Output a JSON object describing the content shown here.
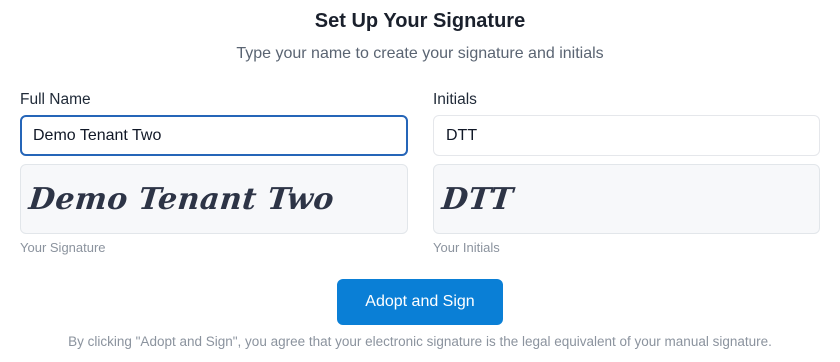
{
  "header": {
    "title": "Set Up Your Signature",
    "subtitle": "Type your name to create your signature and initials"
  },
  "full_name": {
    "label": "Full Name",
    "value": "Demo Tenant Two",
    "preview_text": "Demo Tenant Two",
    "caption": "Your Signature"
  },
  "initials": {
    "label": "Initials",
    "value": "DTT",
    "preview_text": "DTT",
    "caption": "Your Initials"
  },
  "actions": {
    "adopt_label": "Adopt and Sign"
  },
  "footer": {
    "legal_text": "By clicking \"Adopt and Sign\", you agree that your electronic signature is the legal equivalent of your manual signature."
  },
  "colors": {
    "accent": "#0a7fd6",
    "focus_ring": "#2565b8",
    "muted_text": "#8b939e"
  }
}
